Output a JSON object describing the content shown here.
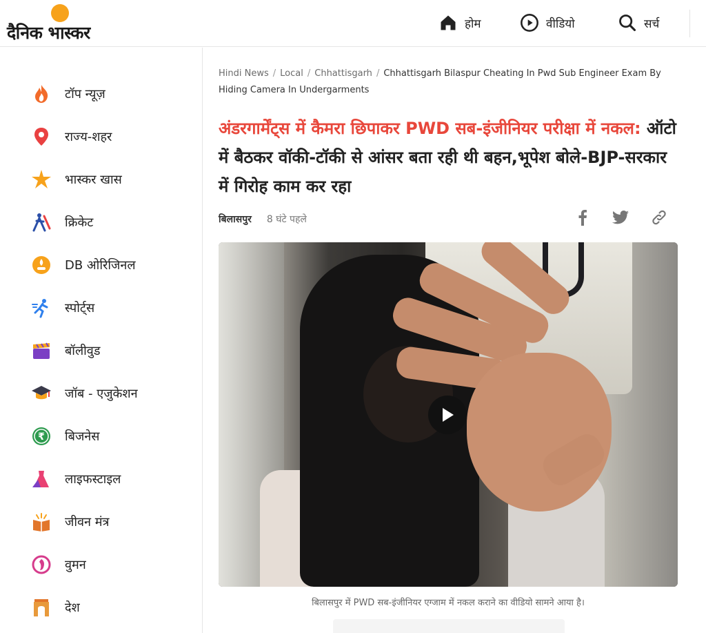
{
  "header": {
    "logo_text": "दैनिक भास्कर",
    "nav": [
      {
        "label": "होम",
        "icon": "home-icon"
      },
      {
        "label": "वीडियो",
        "icon": "play-circle-icon"
      },
      {
        "label": "सर्च",
        "icon": "search-icon"
      }
    ]
  },
  "sidebar": {
    "items": [
      {
        "label": "टॉप न्यूज़",
        "icon": "fire-icon"
      },
      {
        "label": "राज्य-शहर",
        "icon": "location-pin-icon"
      },
      {
        "label": "भास्कर खास",
        "icon": "star-burst-icon"
      },
      {
        "label": "क्रिकेट",
        "icon": "cricket-icon"
      },
      {
        "label": "DB ओरिजिनल",
        "icon": "lamp-icon"
      },
      {
        "label": "स्पोर्ट्स",
        "icon": "runner-icon"
      },
      {
        "label": "बॉलीवुड",
        "icon": "clapperboard-icon"
      },
      {
        "label": "जॉब - एजुकेशन",
        "icon": "graduation-cap-icon"
      },
      {
        "label": "बिजनेस",
        "icon": "rupee-icon"
      },
      {
        "label": "लाइफस्टाइल",
        "icon": "dress-icon"
      },
      {
        "label": "जीवन मंत्र",
        "icon": "book-icon"
      },
      {
        "label": "वुमन",
        "icon": "woman-icon"
      },
      {
        "label": "देश",
        "icon": "india-gate-icon"
      }
    ]
  },
  "breadcrumb": {
    "items": [
      "Hindi News",
      "Local",
      "Chhattisgarh"
    ],
    "current": "Chhattisgarh Bilaspur Cheating In Pwd Sub Engineer Exam By Hiding Camera In Undergarments"
  },
  "article": {
    "headline_red": "अंडरगार्मेंट्स में कैमरा छिपाकर PWD सब-इंजीनियर परीक्षा में नकल:",
    "headline_rest": " ऑटो में बैठकर वॉकी-टॉकी से आंसर बता रही थी बहन,भूपेश बोले-BJP-सरकार में गिरोह काम कर रहा",
    "city": "बिलासपुर",
    "time": "8 घंटे पहले",
    "caption": "बिलासपुर में PWD सब-इंजीनियर एग्जाम में नकल कराने का वीडियो सामने आया है।"
  },
  "colors": {
    "headline_accent": "#e8473b",
    "logo_sun": "#f7a21b"
  }
}
